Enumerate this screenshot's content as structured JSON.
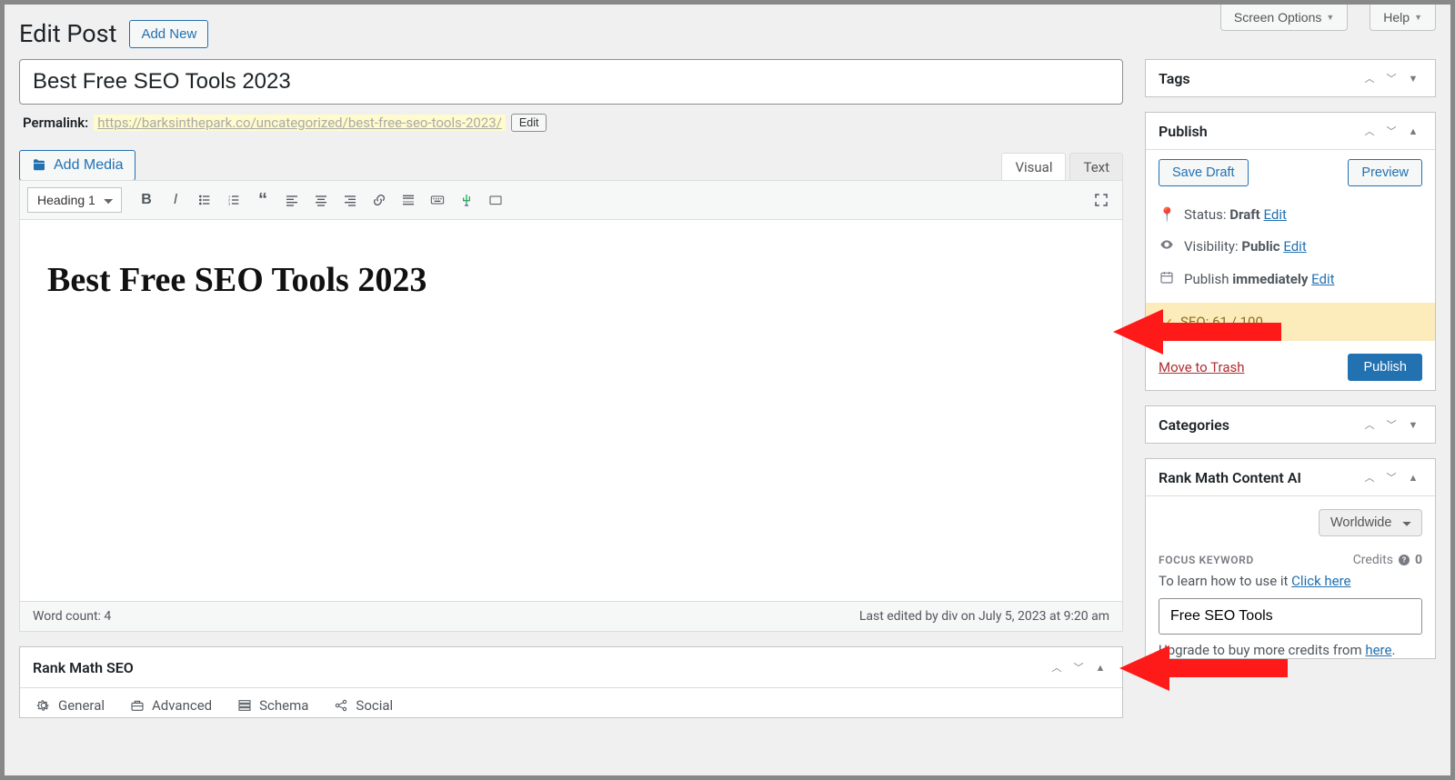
{
  "header": {
    "screen_options": "Screen Options",
    "help": "Help",
    "page_heading": "Edit Post",
    "add_new": "Add New"
  },
  "post": {
    "title": "Best Free SEO Tools 2023",
    "permalink_label": "Permalink:",
    "permalink_url": "https://barksinthepark.co/uncategorized/best-free-seo-tools-2023/",
    "permalink_edit": "Edit",
    "add_media": "Add Media",
    "tabs": {
      "visual": "Visual",
      "text": "Text"
    },
    "format": "Heading 1",
    "content_heading": "Best Free SEO Tools 2023",
    "word_count": "Word count: 4",
    "last_edited": "Last edited by div on July 5, 2023 at 9:20 am"
  },
  "rankmath": {
    "title": "Rank Math SEO",
    "tabs": {
      "general": "General",
      "advanced": "Advanced",
      "schema": "Schema",
      "social": "Social"
    }
  },
  "side": {
    "tags_title": "Tags",
    "publish": {
      "title": "Publish",
      "save_draft": "Save Draft",
      "preview": "Preview",
      "status_label": "Status:",
      "status_value": "Draft",
      "visibility_label": "Visibility:",
      "visibility_value": "Public",
      "publish_label": "Publish",
      "publish_value": "immediately",
      "edit": "Edit",
      "seo_score": "SEO: 61 / 100",
      "trash": "Move to Trash",
      "publish_btn": "Publish"
    },
    "categories_title": "Categories",
    "contentai": {
      "title": "Rank Math Content AI",
      "region": "Worldwide",
      "focus_label": "FOCUS KEYWORD",
      "credits_label": "Credits",
      "credits_value": "0",
      "learn_prefix": "To learn how to use it ",
      "learn_link": "Click here",
      "focus_value": "Free SEO Tools",
      "upgrade_prefix": "Upgrade to buy more credits from ",
      "upgrade_link": "here"
    }
  }
}
